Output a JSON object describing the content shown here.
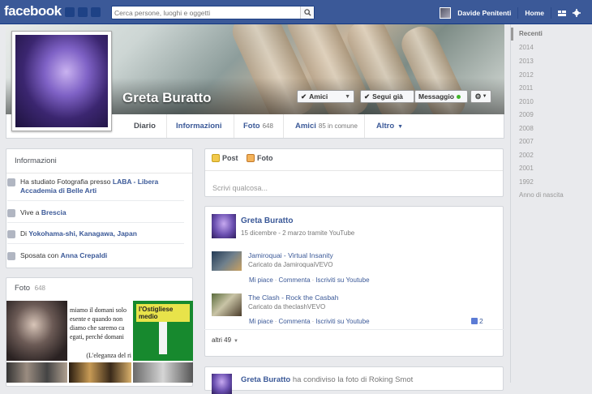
{
  "topbar": {
    "logo": "facebook",
    "search_placeholder": "Cerca persone, luoghi e oggetti",
    "user_name": "Davide Penitenti",
    "home_label": "Home"
  },
  "profile": {
    "name": "Greta Buratto",
    "buttons": {
      "friends": "Amici",
      "following": "Segui già",
      "message": "Messaggio"
    },
    "nav": {
      "diary": "Diario",
      "info": "Informazioni",
      "photos": "Foto",
      "photos_count": "648",
      "friends": "Amici",
      "friends_count": "85 in comune",
      "more": "Altro"
    }
  },
  "info_panel": {
    "title": "Informazioni",
    "items": [
      {
        "prefix": "Ha studiato Fotografia presso ",
        "link": "LABA - Libera Accademia di Belle Arti"
      },
      {
        "prefix": "Vive a ",
        "link": "Brescia"
      },
      {
        "prefix": "Di ",
        "link": "Yokohama-shi, Kanagawa, Japan"
      },
      {
        "prefix": "Sposata con ",
        "link": "Anna Crepaldi"
      }
    ]
  },
  "photos_panel": {
    "title": "Foto",
    "count": "648",
    "text_lines": [
      "miamo il domani solo",
      "esente e quando non",
      "diamo che saremo ca",
      "egati, perché domani",
      "(L'eleganza del ri"
    ],
    "card_title": "l'Ostigliese medio"
  },
  "composer": {
    "tab_post": "Post",
    "tab_photo": "Foto",
    "placeholder": "Scrivi qualcosa..."
  },
  "post1": {
    "author": "Greta Buratto",
    "meta": "15 dicembre - 2 marzo tramite YouTube",
    "shares": [
      {
        "title": "Jamiroquai - Virtual Insanity",
        "sub": "Caricato da JamiroquaiVEVO",
        "actions": [
          "Mi piace",
          "Commenta",
          "Iscriviti su Youtube"
        ]
      },
      {
        "title": "The Clash - Rock the Casbah",
        "sub": "Caricato da theclashVEVO",
        "actions": [
          "Mi piace",
          "Commenta",
          "Iscriviti su Youtube"
        ],
        "likes": "2"
      }
    ],
    "more": "altri 49"
  },
  "post2": {
    "author": "Greta Buratto",
    "text": "ha condiviso la foto di Roking Smot"
  },
  "ticker": {
    "recent": "Recenti",
    "years": [
      "2014",
      "2013",
      "2012",
      "2011",
      "2010",
      "2009",
      "2008",
      "2007",
      "2002",
      "2001",
      "1992"
    ],
    "birth": "Anno di nascita"
  }
}
